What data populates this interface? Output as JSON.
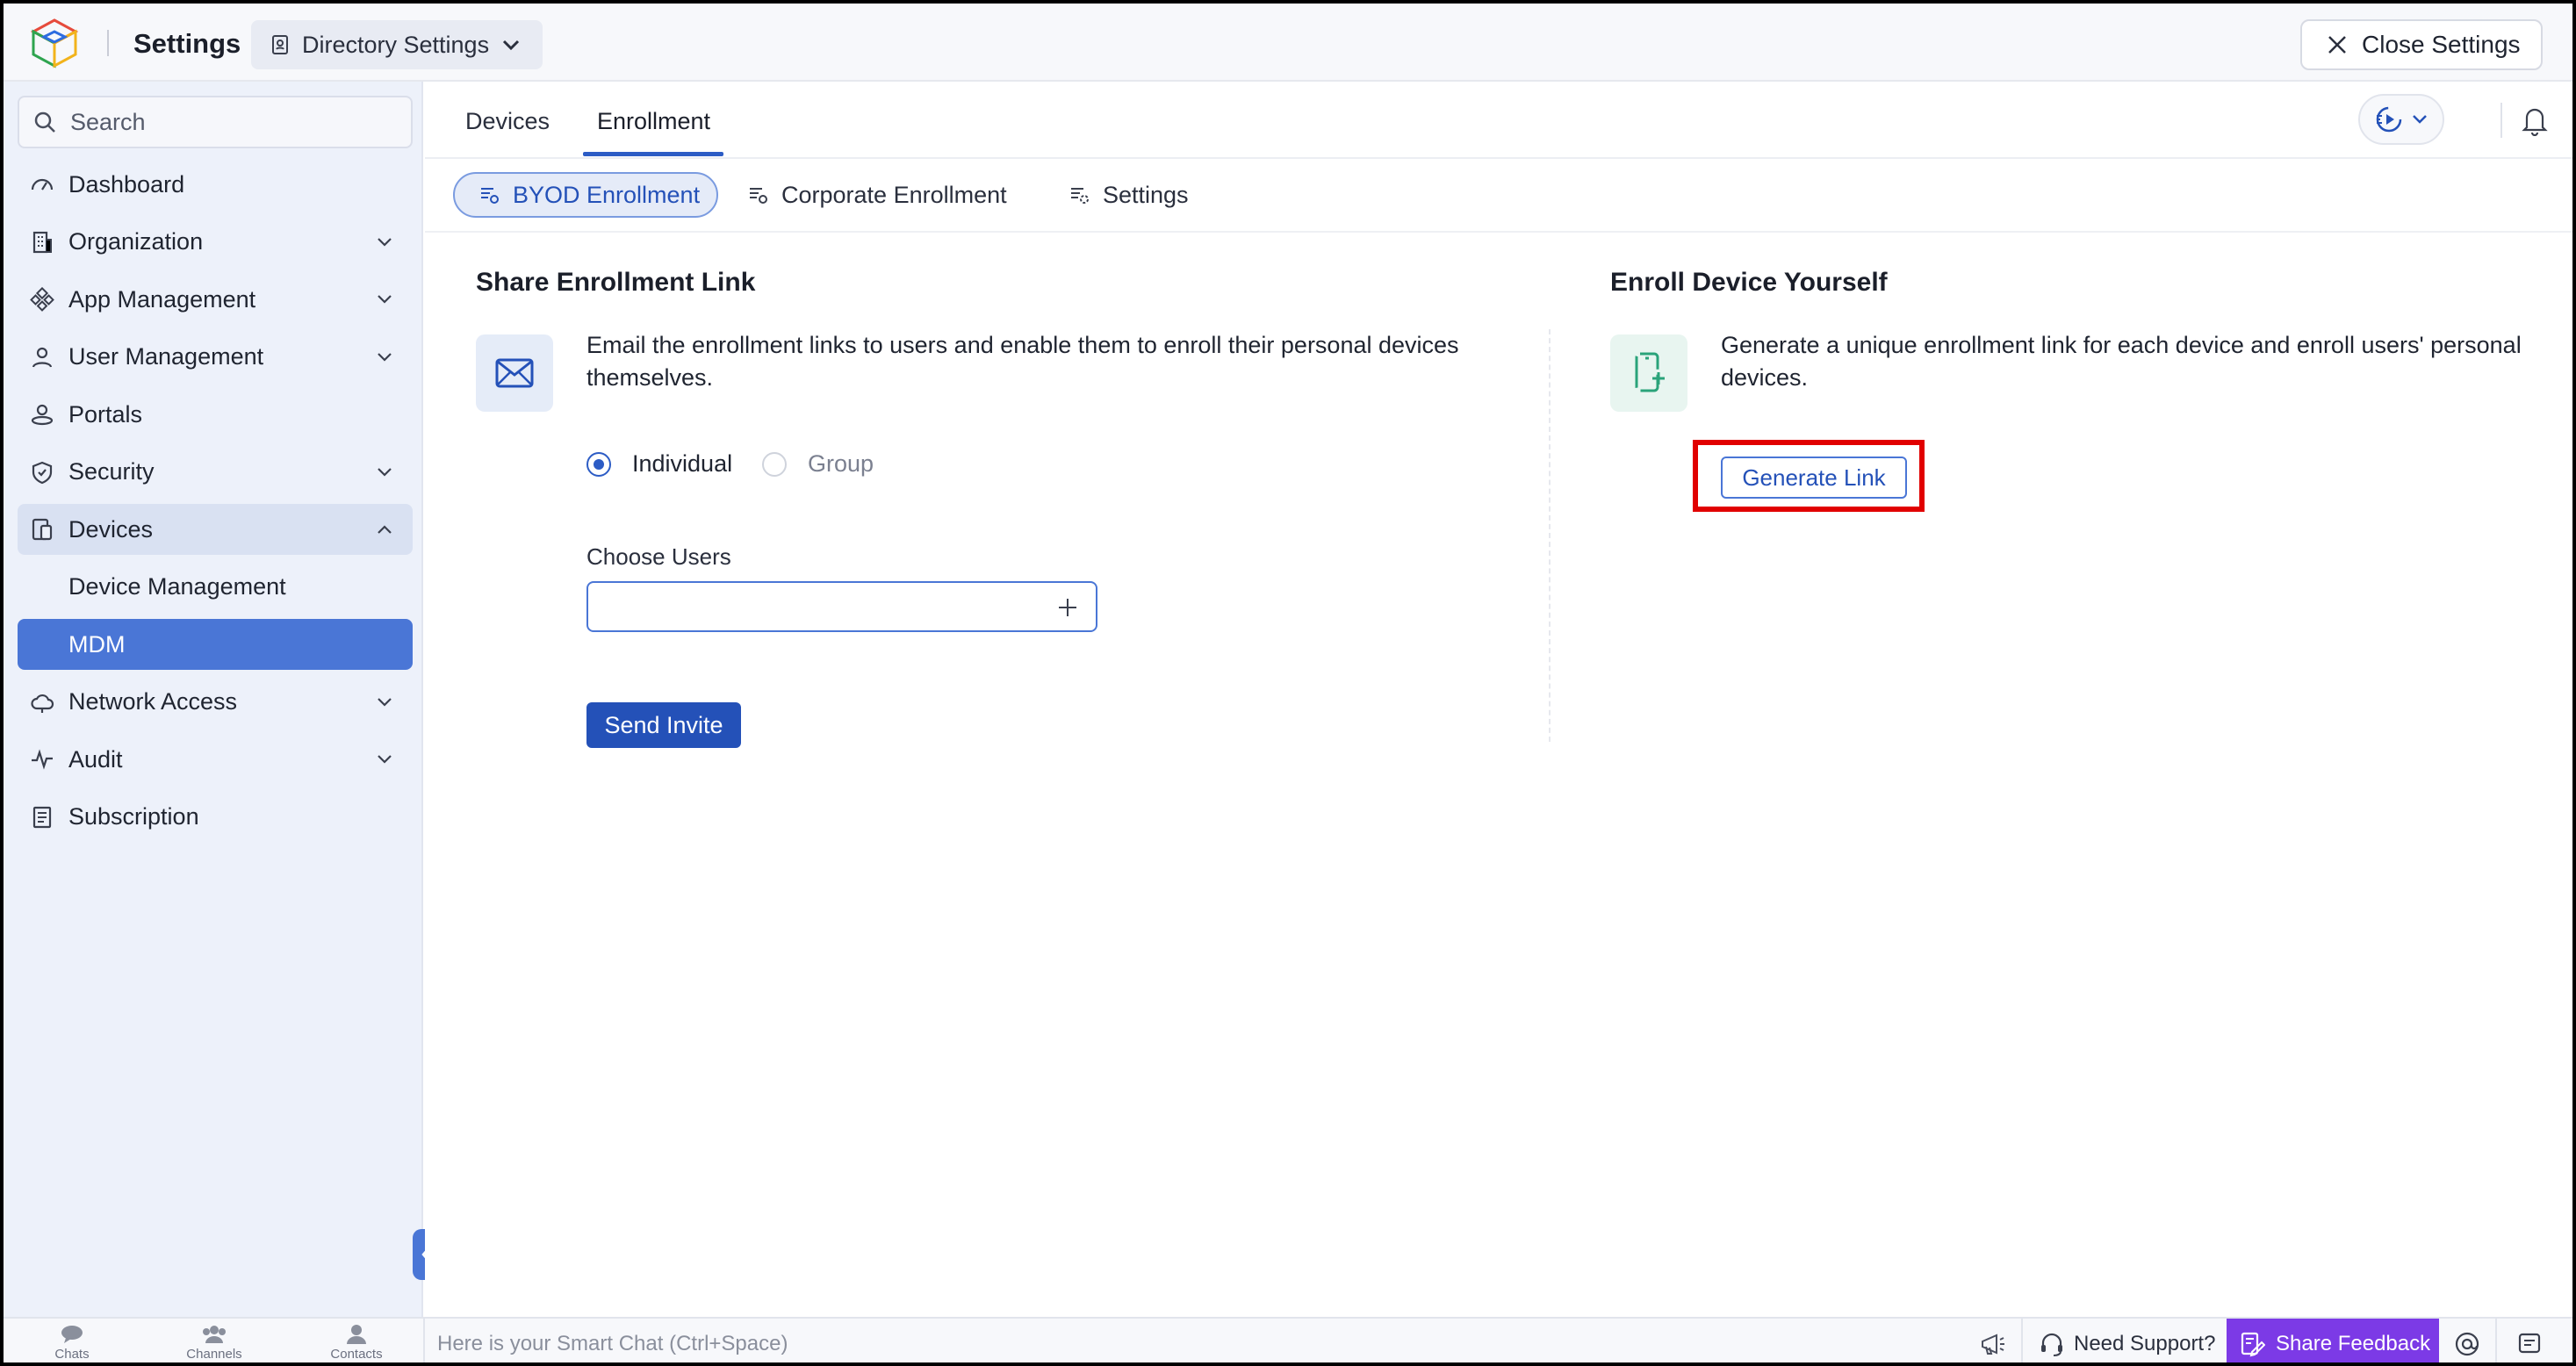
{
  "header": {
    "app_title": "Settings",
    "dropdown_label": "Directory Settings",
    "close_label": "Close Settings"
  },
  "sidebar": {
    "search_placeholder": "Search",
    "items": [
      {
        "label": "Dashboard",
        "icon": "dashboard-icon"
      },
      {
        "label": "Organization",
        "icon": "building-icon",
        "expandable": true
      },
      {
        "label": "App Management",
        "icon": "apps-icon",
        "expandable": true
      },
      {
        "label": "User Management",
        "icon": "user-icon",
        "expandable": true
      },
      {
        "label": "Portals",
        "icon": "portal-icon"
      },
      {
        "label": "Security",
        "icon": "shield-icon",
        "expandable": true
      },
      {
        "label": "Devices",
        "icon": "devices-icon",
        "expandable": true,
        "expanded": true
      },
      {
        "label": "Device Management",
        "sub": true
      },
      {
        "label": "MDM",
        "sub": true,
        "active": true
      },
      {
        "label": "Network Access",
        "icon": "cloud-icon",
        "expandable": true
      },
      {
        "label": "Audit",
        "icon": "pulse-icon",
        "expandable": true
      },
      {
        "label": "Subscription",
        "icon": "document-icon"
      }
    ]
  },
  "tabs": [
    {
      "label": "Devices"
    },
    {
      "label": "Enrollment",
      "active": true
    }
  ],
  "subtabs": [
    {
      "label": "BYOD Enrollment",
      "active": true
    },
    {
      "label": "Corporate Enrollment"
    },
    {
      "label": "Settings"
    }
  ],
  "share": {
    "title": "Share Enrollment Link",
    "description_line1": "Email the enrollment links to users and enable them to enroll their personal devices",
    "description_line2": "themselves.",
    "radio_individual": "Individual",
    "radio_group": "Group",
    "selected_option": "Individual",
    "choose_users_label": "Choose Users",
    "choose_users_value": "",
    "send_invite_label": "Send Invite"
  },
  "enroll": {
    "title": "Enroll Device Yourself",
    "description_line1": "Generate a unique enrollment link for each device and enroll users' personal",
    "description_line2": "devices.",
    "generate_label": "Generate Link"
  },
  "bottombar": {
    "chats": "Chats",
    "channels": "Channels",
    "contacts": "Contacts",
    "smartchat_placeholder": "Here is your Smart Chat (Ctrl+Space)",
    "support_label": "Need Support?",
    "feedback_label": "Share Feedback"
  },
  "colors": {
    "accent": "#2c5cc5",
    "active_nav": "#4a76d6",
    "highlight": "#e10000",
    "feedback": "#7c3ae6"
  }
}
